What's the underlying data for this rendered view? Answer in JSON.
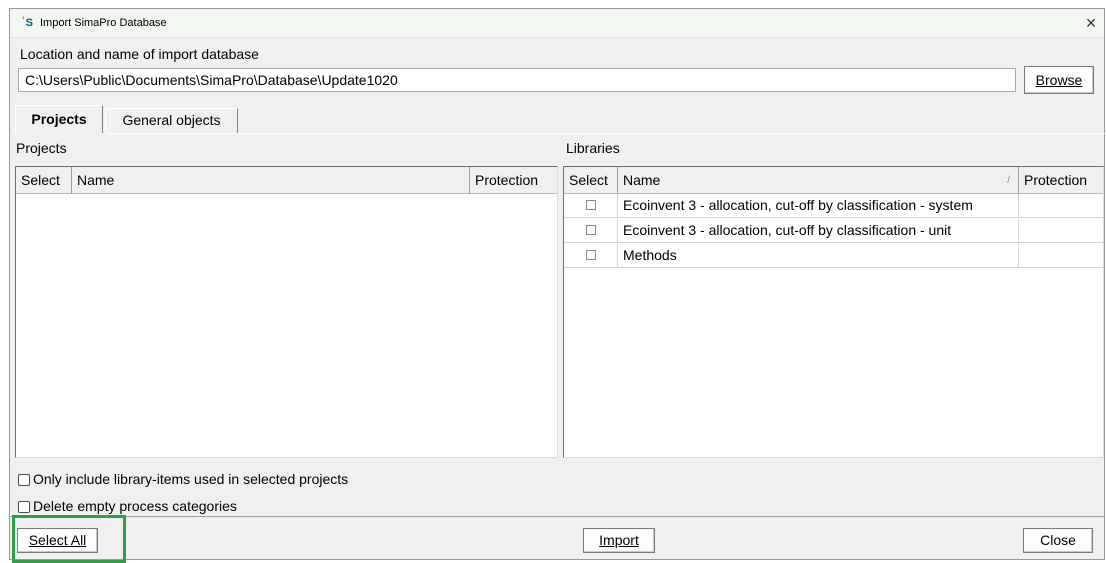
{
  "window": {
    "title": "Import SimaPro Database",
    "close_glyph": "×"
  },
  "location": {
    "label": "Location and name of import database",
    "value": "C:\\Users\\Public\\Documents\\SimaPro\\Database\\Update1020",
    "browse_label": "Browse"
  },
  "tabs": [
    {
      "label": "Projects",
      "active": true
    },
    {
      "label": "General objects",
      "active": false
    }
  ],
  "projects": {
    "heading": "Projects",
    "columns": [
      "Select",
      "Name",
      "Protection"
    ],
    "rows": []
  },
  "libraries": {
    "heading": "Libraries",
    "columns": [
      "Select",
      "Name",
      "Protection"
    ],
    "sort_indicator": "/",
    "rows": [
      {
        "selected": false,
        "name": "Ecoinvent 3 - allocation, cut-off by classification - system",
        "protection": ""
      },
      {
        "selected": false,
        "name": "Ecoinvent 3 - allocation, cut-off by classification - unit",
        "protection": ""
      },
      {
        "selected": false,
        "name": "Methods",
        "protection": ""
      }
    ]
  },
  "options": {
    "only_library_items": {
      "label": "Only include library-items used in selected projects",
      "checked": false
    },
    "delete_empty": {
      "label": "Delete empty process categories",
      "checked": false
    }
  },
  "footer": {
    "select_all_label": "Select All",
    "import_label": "Import",
    "close_label": "Close"
  },
  "colors": {
    "highlight": "#2e9e4b",
    "titlebar": "#f1f8f2",
    "dialog_bg": "#f0f0f0"
  }
}
